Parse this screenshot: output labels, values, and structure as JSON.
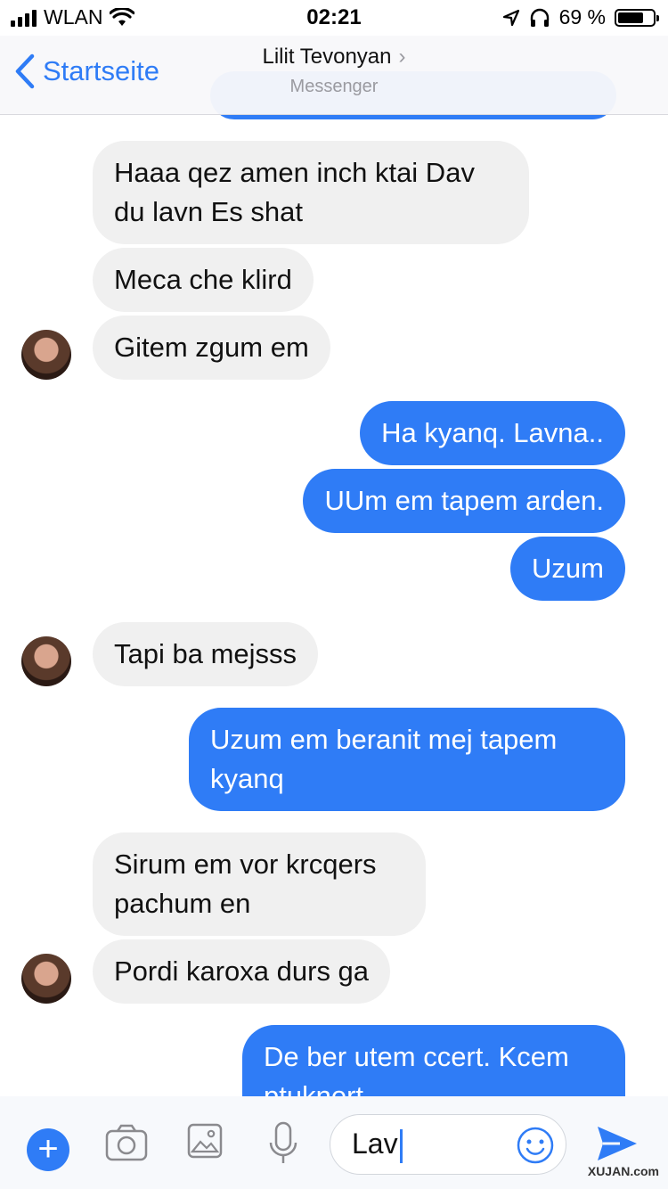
{
  "status": {
    "carrier": "WLAN",
    "time": "02:21",
    "battery": "69 %"
  },
  "nav": {
    "back_label": "Startseite",
    "contact_name": "Lilit Tevonyan",
    "chevron": "›",
    "subtitle": "Messenger"
  },
  "messages": [
    {
      "dir": "in",
      "text": "Haaa qez amen inch ktai Dav du lavn Es shat"
    },
    {
      "dir": "in",
      "text": "Meca che klird"
    },
    {
      "dir": "in",
      "text": "Gitem zgum em"
    },
    {
      "dir": "out",
      "text": "Ha kyanq. Lavna.."
    },
    {
      "dir": "out",
      "text": "UUm em tapem arden."
    },
    {
      "dir": "out",
      "text": "Uzum"
    },
    {
      "dir": "in",
      "text": "Tapi ba mejsss"
    },
    {
      "dir": "out",
      "text": "Uzum  em beranit mej tapem kyanq"
    },
    {
      "dir": "in",
      "text": "Sirum em vor krcqers pachum en"
    },
    {
      "dir": "in",
      "text": "Pordi karoxa durs ga"
    },
    {
      "dir": "out",
      "text": "De ber utem ccert. Kcem ptuknert"
    }
  ],
  "composer": {
    "input_value": "Lav"
  },
  "watermark": "XUJAN.com",
  "colors": {
    "accent": "#2f7cf6",
    "incoming": "#f0f0f0"
  }
}
